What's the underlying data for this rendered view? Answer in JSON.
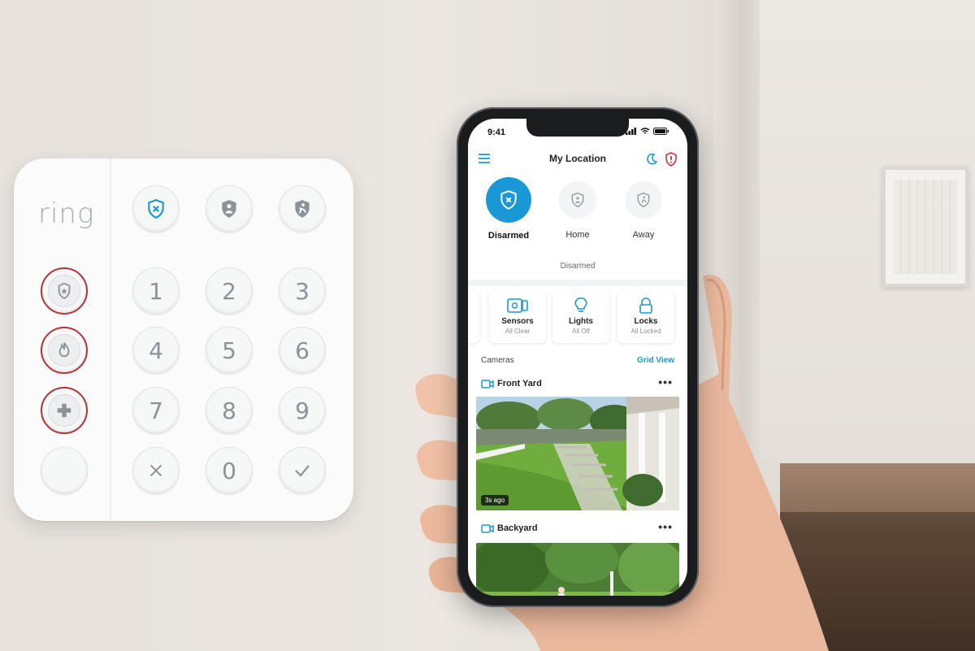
{
  "keypad": {
    "brand": "ring",
    "digits": [
      "1",
      "2",
      "3",
      "4",
      "5",
      "6",
      "7",
      "8",
      "9",
      "0"
    ]
  },
  "phone": {
    "status_time": "9:41",
    "header_title": "My Location",
    "modes": [
      {
        "label": "Disarmed",
        "icon": "shield-x-icon",
        "active": true
      },
      {
        "label": "Home",
        "icon": "home-shield-icon",
        "active": false
      },
      {
        "label": "Away",
        "icon": "away-shield-icon",
        "active": false
      }
    ],
    "security_status": "Disarmed",
    "tiles": [
      {
        "label": "Sensors",
        "sub": "All Clear",
        "icon": "sensor-icon"
      },
      {
        "label": "Lights",
        "sub": "All Off",
        "icon": "bulb-icon"
      },
      {
        "label": "Locks",
        "sub": "All Locked",
        "icon": "lock-icon"
      }
    ],
    "cameras_label": "Cameras",
    "grid_view_label": "Grid View",
    "cameras": [
      {
        "name": "Front Yard",
        "badge": "3s ago"
      },
      {
        "name": "Backyard"
      }
    ],
    "more_label": "•••"
  },
  "colors": {
    "accent": "#1998d5",
    "alert": "#d32f3a",
    "keypad_red_ring": "#b0363a"
  }
}
